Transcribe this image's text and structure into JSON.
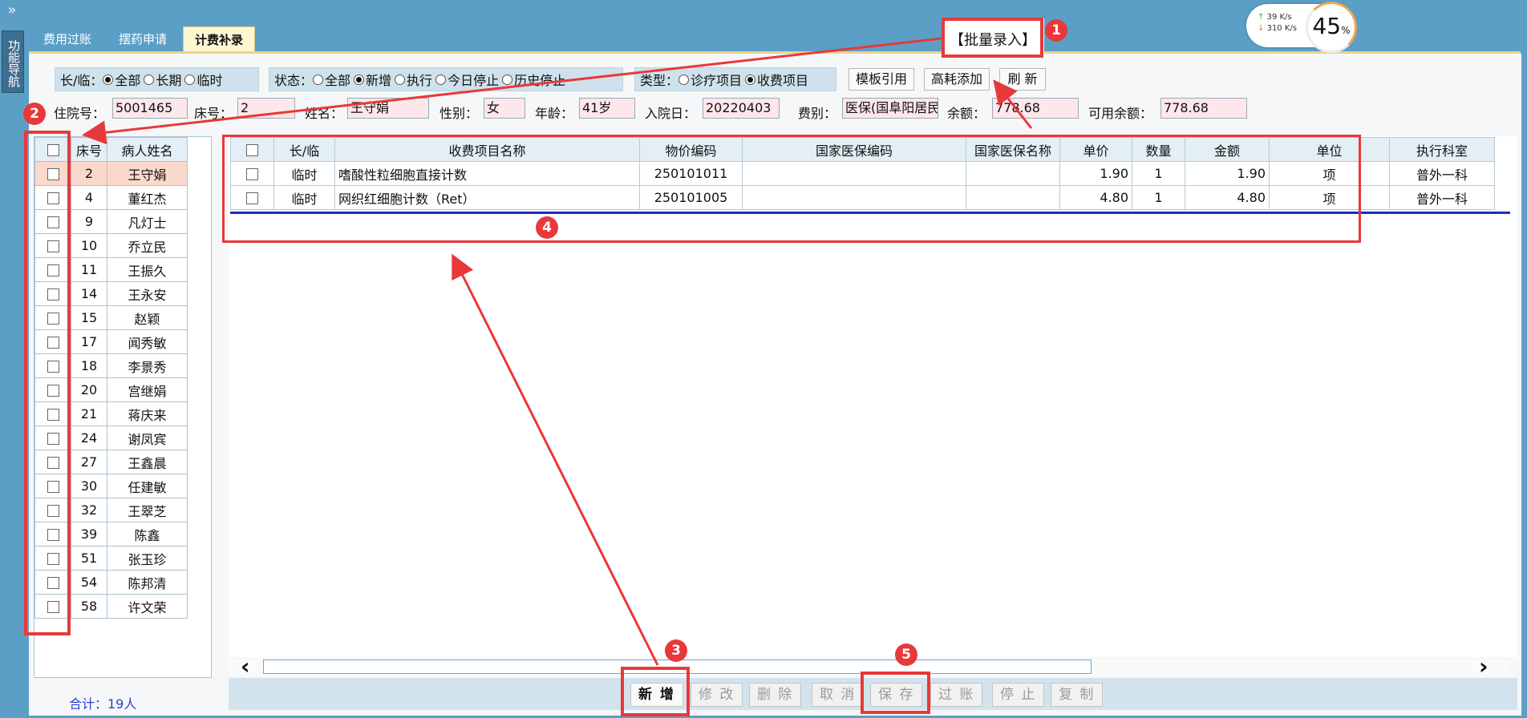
{
  "nav": {
    "toggle_icon": "double-chevron-right-icon",
    "toggle_glyph": "»",
    "function_nav_label": "功能导航"
  },
  "tabs": [
    {
      "label": "费用过账"
    },
    {
      "label": "摆药申请"
    },
    {
      "label": "计费补录"
    }
  ],
  "net_widget": {
    "up_speed": "39 K/s",
    "down_speed": "310 K/s",
    "percent": "45",
    "percent_unit": "%"
  },
  "annotations": {
    "badge1": "1",
    "badge2": "2",
    "badge3": "3",
    "badge4": "4",
    "badge5": "5",
    "batch_entry_label": "【批量录入】",
    "accent_color": "#e8393a"
  },
  "filters": {
    "long_temp": {
      "label": "长/临：",
      "options": [
        "全部",
        "长期",
        "临时"
      ]
    },
    "status": {
      "label": "状态：",
      "options": [
        "全部",
        "新增",
        "执行",
        "今日停止",
        "历史停止"
      ]
    },
    "type": {
      "label": "类型：",
      "options": [
        "诊疗项目",
        "收费项目"
      ]
    },
    "buttons": {
      "template": "模板引用",
      "high_cost": "高耗添加",
      "refresh": "刷 新"
    }
  },
  "patient_info": {
    "admission_no_label": "住院号：",
    "admission_no": "5001465",
    "bed_label": "床号：",
    "bed": "2",
    "name_label": "姓名：",
    "name": "王守娟",
    "gender_label": "性别：",
    "gender": "女",
    "age_label": "年龄：",
    "age": "41岁",
    "admit_date_label": "入院日：",
    "admit_date": "20220403",
    "fee_type_label": "费别：",
    "fee_type": "医保(国阜阳居民",
    "balance_label": "余额：",
    "balance": "778.68",
    "avail_label": "可用余额：",
    "avail": "778.68"
  },
  "patients": {
    "headers": [
      "床号",
      "病人姓名"
    ],
    "rows": [
      {
        "bed": "2",
        "name": "王守娟"
      },
      {
        "bed": "4",
        "name": "董红杰"
      },
      {
        "bed": "9",
        "name": "凡灯士"
      },
      {
        "bed": "10",
        "name": "乔立民"
      },
      {
        "bed": "11",
        "name": "王振久"
      },
      {
        "bed": "14",
        "name": "王永安"
      },
      {
        "bed": "15",
        "name": "赵颖"
      },
      {
        "bed": "17",
        "name": "闻秀敏"
      },
      {
        "bed": "18",
        "name": "李景秀"
      },
      {
        "bed": "20",
        "name": "宫继娟"
      },
      {
        "bed": "21",
        "name": "蒋庆来"
      },
      {
        "bed": "24",
        "name": "谢凤宾"
      },
      {
        "bed": "27",
        "name": "王鑫晨"
      },
      {
        "bed": "30",
        "name": "任建敏"
      },
      {
        "bed": "32",
        "name": "王翠芝"
      },
      {
        "bed": "39",
        "name": "陈鑫"
      },
      {
        "bed": "51",
        "name": "张玉珍"
      },
      {
        "bed": "54",
        "name": "陈邦清"
      },
      {
        "bed": "58",
        "name": "许文荣"
      }
    ],
    "total": "合计：19人"
  },
  "items": {
    "headers": [
      "长/临",
      "收费项目名称",
      "物价编码",
      "国家医保编码",
      "国家医保名称",
      "单价",
      "数量",
      "金额",
      "单位",
      "执行科室"
    ],
    "rows": [
      {
        "type": "临时",
        "name": "嗜酸性粒细胞直接计数",
        "price_code": "250101011",
        "ins_code": "",
        "ins_name": "",
        "unit_price": "1.90",
        "qty": "1",
        "amount": "1.90",
        "unit": "项",
        "dept": "普外一科"
      },
      {
        "type": "临时",
        "name": "网织红细胞计数（Ret）",
        "price_code": "250101005",
        "ins_code": "",
        "ins_name": "",
        "unit_price": "4.80",
        "qty": "1",
        "amount": "4.80",
        "unit": "项",
        "dept": "普外一科"
      }
    ]
  },
  "scroll": {
    "left": "‹",
    "right": "›"
  },
  "actions": {
    "add": "新 增",
    "edit": "修 改",
    "delete": "删 除",
    "cancel": "取 消",
    "save": "保 存",
    "post": "过 账",
    "stop": "停 止",
    "copy": "复 制"
  }
}
